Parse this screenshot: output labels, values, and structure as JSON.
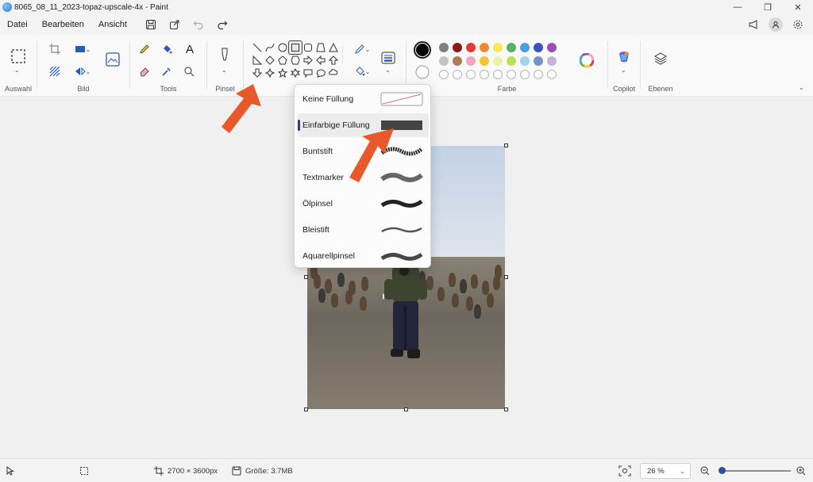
{
  "window": {
    "title": "8065_08_11_2023-topaz-upscale-4x - Paint",
    "minimize": "—",
    "restore": "❐",
    "close": "✕"
  },
  "menu": [
    "Datei",
    "Bearbeiten",
    "Ansicht"
  ],
  "ribbon": {
    "groups": {
      "auswahl": "Auswahl",
      "bild": "Bild",
      "tools": "Tools",
      "pinsel": "Pinsel",
      "farbe": "Farbe",
      "copilot": "Copilot",
      "ebenen": "Ebenen"
    },
    "tool_glyphs": {
      "text": "A"
    }
  },
  "colors": {
    "primary": "#000000",
    "row1": [
      "#000000",
      "#7f7f7f",
      "#8b1a1a",
      "#e53935",
      "#f28a2b",
      "#f5e85a",
      "#55b45f",
      "#4a9fe0",
      "#3d4fc4",
      "#9b4fb5"
    ],
    "row2": [
      "#ffffff",
      "#c3c3c3",
      "#b07a5c",
      "#f2a6c1",
      "#f4c431",
      "#eef2a8",
      "#b8e25a",
      "#9fd6ee",
      "#7393c8",
      "#c3b4dc"
    ],
    "empty_count": 10
  },
  "fill_menu": {
    "items": [
      {
        "label": "Keine Füllung",
        "kind": "none"
      },
      {
        "label": "Einfarbige Füllung",
        "kind": "solid",
        "active": true
      },
      {
        "label": "Buntstift",
        "kind": "crayon"
      },
      {
        "label": "Textmarker",
        "kind": "marker"
      },
      {
        "label": "Ölpinsel",
        "kind": "oil"
      },
      {
        "label": "Bleistift",
        "kind": "pencil"
      },
      {
        "label": "Aquarellpinsel",
        "kind": "watercolor"
      }
    ]
  },
  "annotation_color": "#e8592a",
  "status": {
    "dimensions": "2700 × 3600px",
    "size": "Größe: 3.7MB",
    "zoom": "26 %"
  }
}
